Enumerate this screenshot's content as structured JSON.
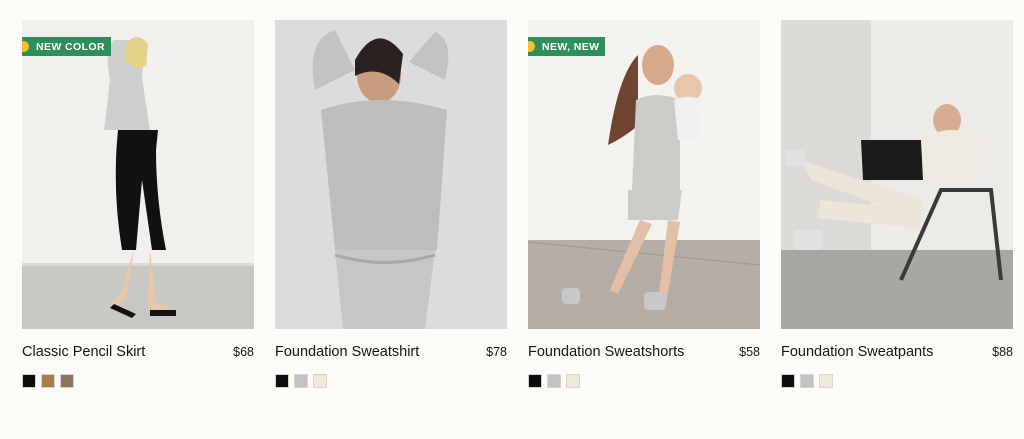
{
  "products": [
    {
      "name": "Classic Pencil Skirt",
      "price": "$68",
      "badge": "NEW COLOR",
      "swatches": [
        "#0e0e0e",
        "#a57c4a",
        "#8c7560"
      ]
    },
    {
      "name": "Foundation Sweatshirt",
      "price": "$78",
      "badge": "",
      "swatches": [
        "#0e0e0e",
        "#c2c2c2",
        "#ede8dc"
      ]
    },
    {
      "name": "Foundation Sweatshorts",
      "price": "$58",
      "badge": "NEW, NEW",
      "swatches": [
        "#0e0e0e",
        "#c2c2c2",
        "#ede8dc"
      ]
    },
    {
      "name": "Foundation Sweatpants",
      "price": "$88",
      "badge": "",
      "swatches": [
        "#0e0e0e",
        "#c2c2c2",
        "#ede8dc"
      ]
    }
  ],
  "colors": {
    "badge_bg": "#2f8f5b",
    "badge_dot": "#f2c230"
  }
}
